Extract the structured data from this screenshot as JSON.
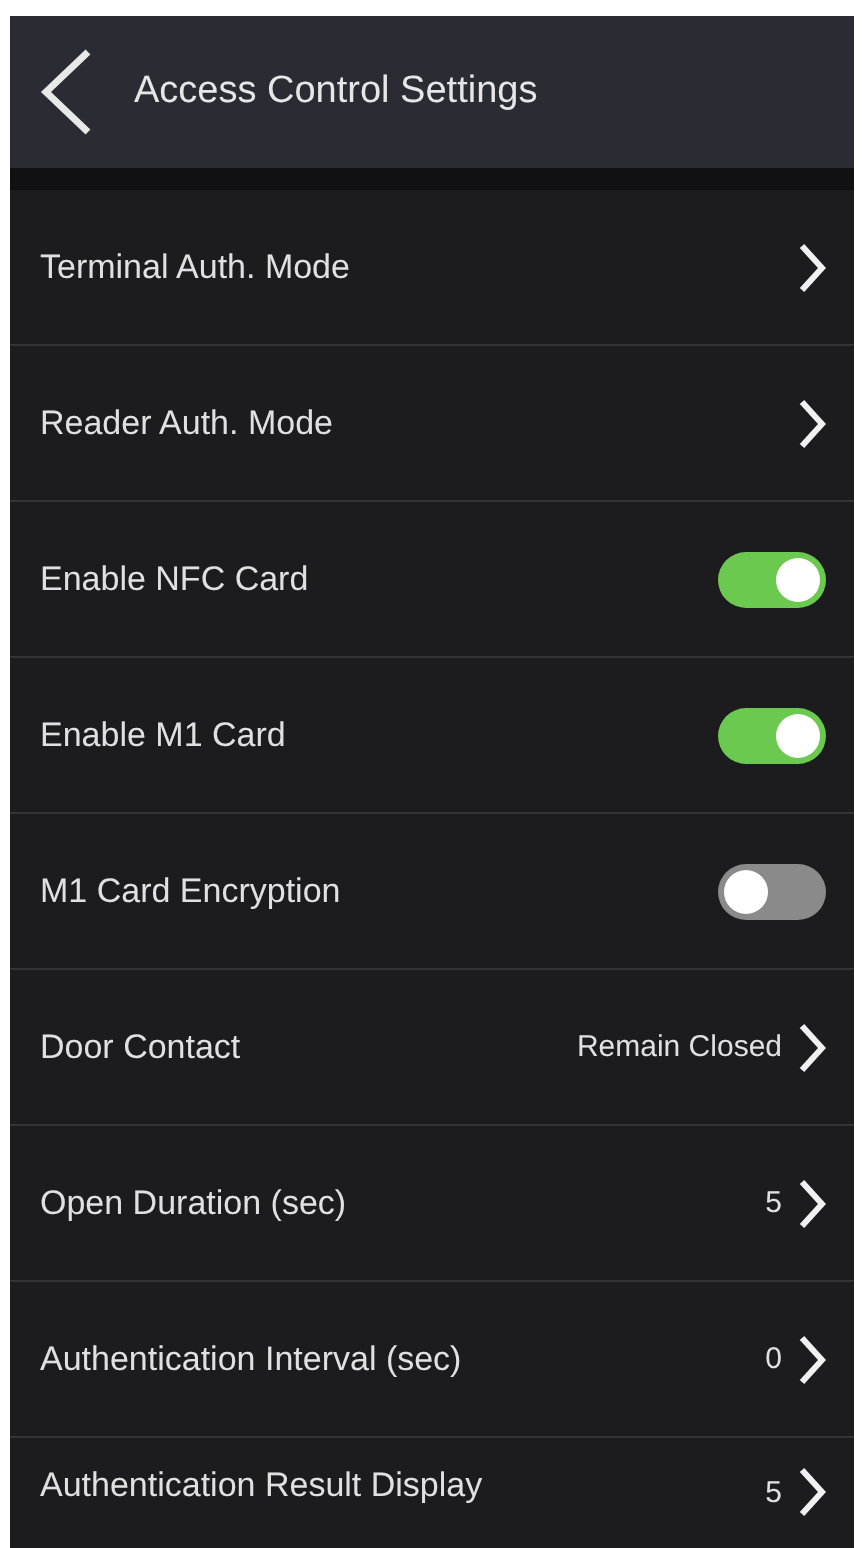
{
  "header": {
    "title": "Access Control Settings"
  },
  "settings": [
    {
      "kind": "nav",
      "label": "Terminal Auth. Mode"
    },
    {
      "kind": "nav",
      "label": "Reader Auth. Mode"
    },
    {
      "kind": "toggle",
      "label": "Enable NFC Card",
      "on": true
    },
    {
      "kind": "toggle",
      "label": "Enable M1 Card",
      "on": true
    },
    {
      "kind": "toggle",
      "label": "M1 Card Encryption",
      "on": false
    },
    {
      "kind": "nav",
      "label": "Door Contact",
      "value": "Remain Closed"
    },
    {
      "kind": "nav",
      "label": "Open Duration (sec)",
      "value": "5"
    },
    {
      "kind": "nav",
      "label": "Authentication Interval (sec)",
      "value": "0"
    },
    {
      "kind": "nav",
      "label": "Authentication Result Display",
      "value": "5"
    }
  ]
}
